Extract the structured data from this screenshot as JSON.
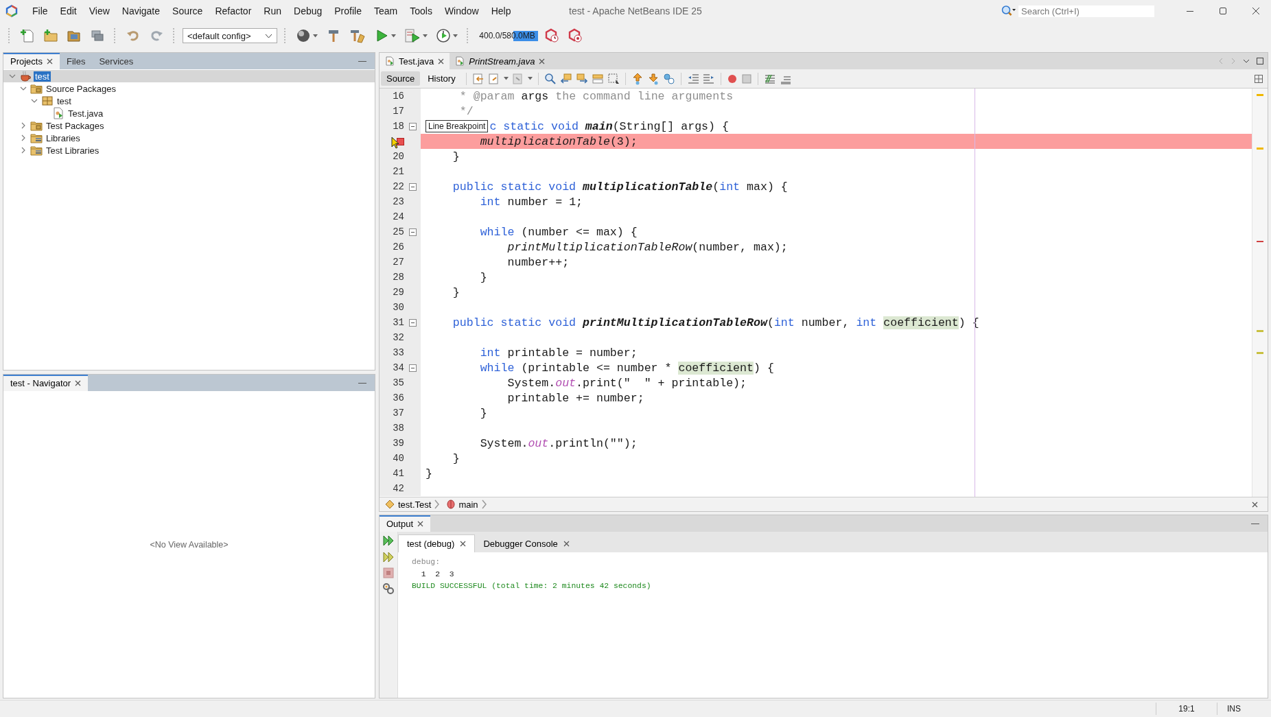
{
  "window": {
    "title": "test - Apache NetBeans IDE 25",
    "search_placeholder": "Search (Ctrl+I)"
  },
  "menu": [
    "File",
    "Edit",
    "View",
    "Navigate",
    "Source",
    "Refactor",
    "Run",
    "Debug",
    "Profile",
    "Team",
    "Tools",
    "Window",
    "Help"
  ],
  "toolbar": {
    "config": "<default config>",
    "memory": {
      "reading": "400.0/580.0MB",
      "level": 0.4
    }
  },
  "projects_panel": {
    "tabs": [
      {
        "label": "Projects",
        "selected": true
      },
      {
        "label": "Files",
        "selected": false
      },
      {
        "label": "Services",
        "selected": false
      }
    ],
    "tree": [
      {
        "label": "test",
        "kind": "project",
        "selected": true,
        "expanded": true,
        "children": [
          {
            "label": "Source Packages",
            "kind": "folder",
            "selected": false,
            "expanded": true,
            "children": [
              {
                "label": "test",
                "kind": "package",
                "selected": false,
                "expanded": true,
                "children": [
                  {
                    "label": "Test.java",
                    "kind": "java",
                    "selected": false
                  }
                ]
              }
            ]
          },
          {
            "label": "Test Packages",
            "kind": "folder",
            "selected": false,
            "expanded": false
          },
          {
            "label": "Libraries",
            "kind": "library",
            "selected": false,
            "expanded": false
          },
          {
            "label": "Test Libraries",
            "kind": "library",
            "selected": false,
            "expanded": false
          }
        ]
      }
    ]
  },
  "navigator": {
    "tab": "test - Navigator",
    "empty_text": "<No View Available>"
  },
  "editor": {
    "tabs": [
      {
        "label": "Test.java",
        "selected": true,
        "italic": false
      },
      {
        "label": "PrintStream.java",
        "selected": false,
        "italic": true
      }
    ],
    "views": [
      {
        "label": "Source",
        "selected": true
      },
      {
        "label": "History",
        "selected": false
      }
    ],
    "lines": [
      {
        "number": "16",
        "breakpoint": false,
        "fold": false,
        "tokens": [
          {
            "text": "     * @param ",
            "kind": "comment"
          },
          {
            "text": "args",
            "kind": "plain"
          },
          {
            "text": " the command line arguments",
            "kind": "comment"
          }
        ]
      },
      {
        "number": "17",
        "breakpoint": false,
        "fold": false,
        "tokens": [
          {
            "text": "     */",
            "kind": "comment"
          }
        ]
      },
      {
        "number": "18",
        "breakpoint": false,
        "fold": true,
        "tooltip": "Line Breakpoint",
        "tokens": [
          {
            "text": "c static void ",
            "kind": "keyword"
          },
          {
            "text": "main",
            "kind": "method"
          },
          {
            "text": "(String[] args) {",
            "kind": "plain"
          }
        ]
      },
      {
        "breakpoint": true,
        "fold": false,
        "tokens": [
          {
            "text": "        multiplicationTable",
            "kind": "call"
          },
          {
            "text": "(3);",
            "kind": "plain"
          }
        ]
      },
      {
        "number": "20",
        "breakpoint": false,
        "fold": false,
        "tokens": [
          {
            "text": "    }",
            "kind": "plain"
          }
        ]
      },
      {
        "number": "21",
        "breakpoint": false,
        "fold": false
      },
      {
        "number": "22",
        "breakpoint": false,
        "fold": true,
        "tokens": [
          {
            "text": "    public static void ",
            "kind": "keyword"
          },
          {
            "text": "multiplicationTable",
            "kind": "method"
          },
          {
            "text": "(",
            "kind": "plain"
          },
          {
            "text": "int",
            "kind": "keyword"
          },
          {
            "text": " max) {",
            "kind": "plain"
          }
        ]
      },
      {
        "number": "23",
        "breakpoint": false,
        "fold": false,
        "tokens": [
          {
            "text": "        int",
            "kind": "keyword"
          },
          {
            "text": " number = 1;",
            "kind": "plain"
          }
        ]
      },
      {
        "number": "24",
        "breakpoint": false,
        "fold": false
      },
      {
        "number": "25",
        "breakpoint": false,
        "fold": true,
        "tokens": [
          {
            "text": "        while",
            "kind": "keyword"
          },
          {
            "text": " (number <= max) {",
            "kind": "plain"
          }
        ]
      },
      {
        "number": "26",
        "breakpoint": false,
        "fold": false,
        "tokens": [
          {
            "text": "            printMultiplicationTableRow",
            "kind": "call"
          },
          {
            "text": "(number, max);",
            "kind": "plain"
          }
        ]
      },
      {
        "number": "27",
        "breakpoint": false,
        "fold": false,
        "tokens": [
          {
            "text": "            number++;",
            "kind": "plain"
          }
        ]
      },
      {
        "number": "28",
        "breakpoint": false,
        "fold": false,
        "tokens": [
          {
            "text": "        }",
            "kind": "plain"
          }
        ]
      },
      {
        "number": "29",
        "breakpoint": false,
        "fold": false,
        "tokens": [
          {
            "text": "    }",
            "kind": "plain"
          }
        ]
      },
      {
        "number": "30",
        "breakpoint": false,
        "fold": false
      },
      {
        "number": "31",
        "breakpoint": false,
        "fold": true,
        "tokens": [
          {
            "text": "    public static void ",
            "kind": "keyword"
          },
          {
            "text": "printMultiplicationTableRow",
            "kind": "method"
          },
          {
            "text": "(",
            "kind": "plain"
          },
          {
            "text": "int",
            "kind": "keyword"
          },
          {
            "text": " number, ",
            "kind": "plain"
          },
          {
            "text": "int ",
            "kind": "keyword"
          },
          {
            "text": "coefficient",
            "kind": "mark"
          },
          {
            "text": ") {",
            "kind": "plain"
          }
        ]
      },
      {
        "number": "32",
        "breakpoint": false,
        "fold": false
      },
      {
        "number": "33",
        "breakpoint": false,
        "fold": false,
        "tokens": [
          {
            "text": "        int",
            "kind": "keyword"
          },
          {
            "text": " printable = number;",
            "kind": "plain"
          }
        ]
      },
      {
        "number": "34",
        "breakpoint": false,
        "fold": true,
        "tokens": [
          {
            "text": "        while",
            "kind": "keyword"
          },
          {
            "text": " (printable <= number * ",
            "kind": "plain"
          },
          {
            "text": "coefficient",
            "kind": "mark"
          },
          {
            "text": ") {",
            "kind": "plain"
          }
        ]
      },
      {
        "number": "35",
        "breakpoint": false,
        "fold": false,
        "tokens": [
          {
            "text": "            System.",
            "kind": "plain"
          },
          {
            "text": "out",
            "kind": "field"
          },
          {
            "text": ".print(\"  \" + printable);",
            "kind": "plain"
          }
        ]
      },
      {
        "number": "36",
        "breakpoint": false,
        "fold": false,
        "tokens": [
          {
            "text": "            printable += number;",
            "kind": "plain"
          }
        ]
      },
      {
        "number": "37",
        "breakpoint": false,
        "fold": false,
        "tokens": [
          {
            "text": "        }",
            "kind": "plain"
          }
        ]
      },
      {
        "number": "38",
        "breakpoint": false,
        "fold": false
      },
      {
        "number": "39",
        "breakpoint": false,
        "fold": false,
        "tokens": [
          {
            "text": "        System.",
            "kind": "plain"
          },
          {
            "text": "out",
            "kind": "field"
          },
          {
            "text": ".println(\"\");",
            "kind": "plain"
          }
        ]
      },
      {
        "number": "40",
        "breakpoint": false,
        "fold": false,
        "tokens": [
          {
            "text": "    }",
            "kind": "plain"
          }
        ]
      },
      {
        "number": "41",
        "breakpoint": false,
        "fold": false,
        "tokens": [
          {
            "text": "}",
            "kind": "plain"
          }
        ]
      },
      {
        "number": "42",
        "breakpoint": false,
        "fold": false
      }
    ],
    "breadcrumbs": [
      {
        "label": "test.Test",
        "kind": "class"
      },
      {
        "label": "main",
        "kind": "method"
      }
    ]
  },
  "output": {
    "title": "Output",
    "tabs": [
      {
        "label": "test (debug)",
        "selected": true
      },
      {
        "label": "Debugger Console",
        "selected": false
      }
    ],
    "lines": [
      {
        "text": "debug:",
        "kind": "info"
      },
      {
        "text": "  1  2  3",
        "kind": "plain"
      },
      {
        "text": "BUILD SUCCESSFUL (total time: 2 minutes 42 seconds)",
        "kind": "success"
      }
    ]
  },
  "status_bar": {
    "position": "19:1",
    "mode": "INS"
  }
}
